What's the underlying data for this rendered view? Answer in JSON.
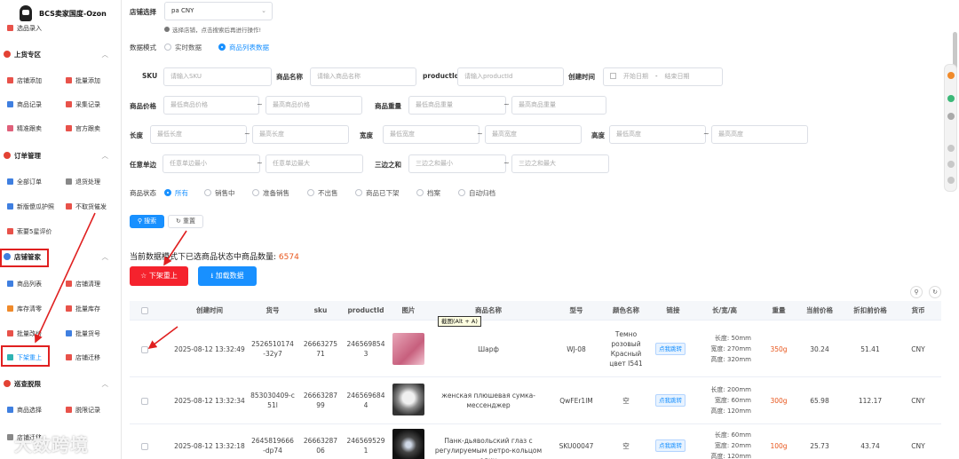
{
  "sidebar": {
    "brand_title": "BCS卖家国度-Ozon",
    "top_item": "选品录入",
    "groups": [
      {
        "title": "上货专区",
        "items": [
          "店铺添加",
          "批量添加",
          "商品记录",
          "采集记录",
          "精准跟卖",
          "官方跟卖"
        ]
      },
      {
        "title": "订单管理",
        "items": [
          "全部订单",
          "退货处理",
          "新版傻瓜护照",
          "不取货催发",
          "索要5星评价"
        ]
      },
      {
        "title": "店铺管家",
        "items": [
          "商品列表",
          "店铺清理",
          "库存清零",
          "批量库存",
          "批量改价",
          "批量货号",
          "下架重上",
          "店铺迁移"
        ]
      },
      {
        "title": "巡查脱限",
        "items": [
          "商品选择",
          "脱限记录"
        ]
      }
    ],
    "partial_bottom": "店铺迁移"
  },
  "filters": {
    "store_label": "店铺选择",
    "store_value": "pa CNY",
    "store_hint": "选择店铺，点击搜索后再进行操作!",
    "mode_label": "数据模式",
    "mode_options": [
      "实时数据",
      "商品列表数据"
    ],
    "sku_label": "SKU",
    "sku_placeholder": "请输入SKU",
    "name_label": "商品名称",
    "name_placeholder": "请输入商品名称",
    "pid_label": "productId",
    "pid_placeholder": "请输入productId",
    "created_label": "创建时间",
    "start_date": "开始日期",
    "end_date": "结束日期",
    "date_sep": "-",
    "price_label": "商品价格",
    "price_min": "最低商品价格",
    "price_max": "最高商品价格",
    "weight_label": "商品重量",
    "weight_min": "最低商品重量",
    "weight_max": "最高商品重量",
    "length_label": "长度",
    "length_min": "最低长度",
    "length_max": "最高长度",
    "width_label": "宽度",
    "width_min": "最低宽度",
    "width_max": "最高宽度",
    "height_label": "高度",
    "height_min": "最低高度",
    "height_max": "最高高度",
    "anyside_label": "任意单边",
    "anyside_min": "任意单边最小",
    "anyside_max": "任意单边最大",
    "sum3_label": "三边之和",
    "sum3_min": "三边之和最小",
    "sum3_max": "三边之和最大",
    "status_label": "商品状态",
    "status_options": [
      "所有",
      "销售中",
      "准备销售",
      "不出售",
      "商品已下架",
      "档案",
      "自动归档"
    ],
    "tilde": "~",
    "search_btn": "搜索",
    "reset_btn": "重置"
  },
  "summary": {
    "text": "当前数据模式下已选商品状态中商品数量:",
    "count": "6574"
  },
  "actions": {
    "relist": "下架重上",
    "load": "加载数据"
  },
  "tooltip": "截图(Alt + A)",
  "table": {
    "columns": [
      "创建时间",
      "货号",
      "sku",
      "productId",
      "图片",
      "商品名称",
      "型号",
      "颜色名称",
      "链接",
      "长/宽/高",
      "重量",
      "当前价格",
      "折扣前价格",
      "货币"
    ],
    "link_text": "点我跳转",
    "dim_labels": [
      "长度:",
      "宽度:",
      "高度:"
    ],
    "rows": [
      {
        "created": "2025-08-12 13:32:49",
        "code": "2526510174-32y7",
        "sku": "2666327571",
        "pid": "2465698543",
        "name": "Шарф",
        "model": "WJ-08",
        "color": "Темно розовый Красный цвет I541",
        "len": "50mm",
        "wid": "270mm",
        "hei": "320mm",
        "weight": "350g",
        "price": "30.24",
        "old_price": "51.41",
        "currency": "CNY"
      },
      {
        "created": "2025-08-12 13:32:34",
        "code": "853030409-c51l",
        "sku": "2666328799",
        "pid": "2465696844",
        "name": "женская плюшевая сумка-мессенджер",
        "model": "QwFEr1lM",
        "color": "空",
        "len": "200mm",
        "wid": "60mm",
        "hei": "120mm",
        "weight": "300g",
        "price": "65.98",
        "old_price": "112.17",
        "currency": "CNY"
      },
      {
        "created": "2025-08-12 13:32:18",
        "code": "2645819666-dp74",
        "sku": "2666328706",
        "pid": "2465695291",
        "name": "Панк-дьявольский глаз с регулируемым ретро-кольцом один",
        "model": "SKU00047",
        "color": "空",
        "len": "60mm",
        "wid": "20mm",
        "hei": "120mm",
        "weight": "100g",
        "price": "25.73",
        "old_price": "43.74",
        "currency": "CNY"
      }
    ]
  },
  "watermark": "大数跨境"
}
